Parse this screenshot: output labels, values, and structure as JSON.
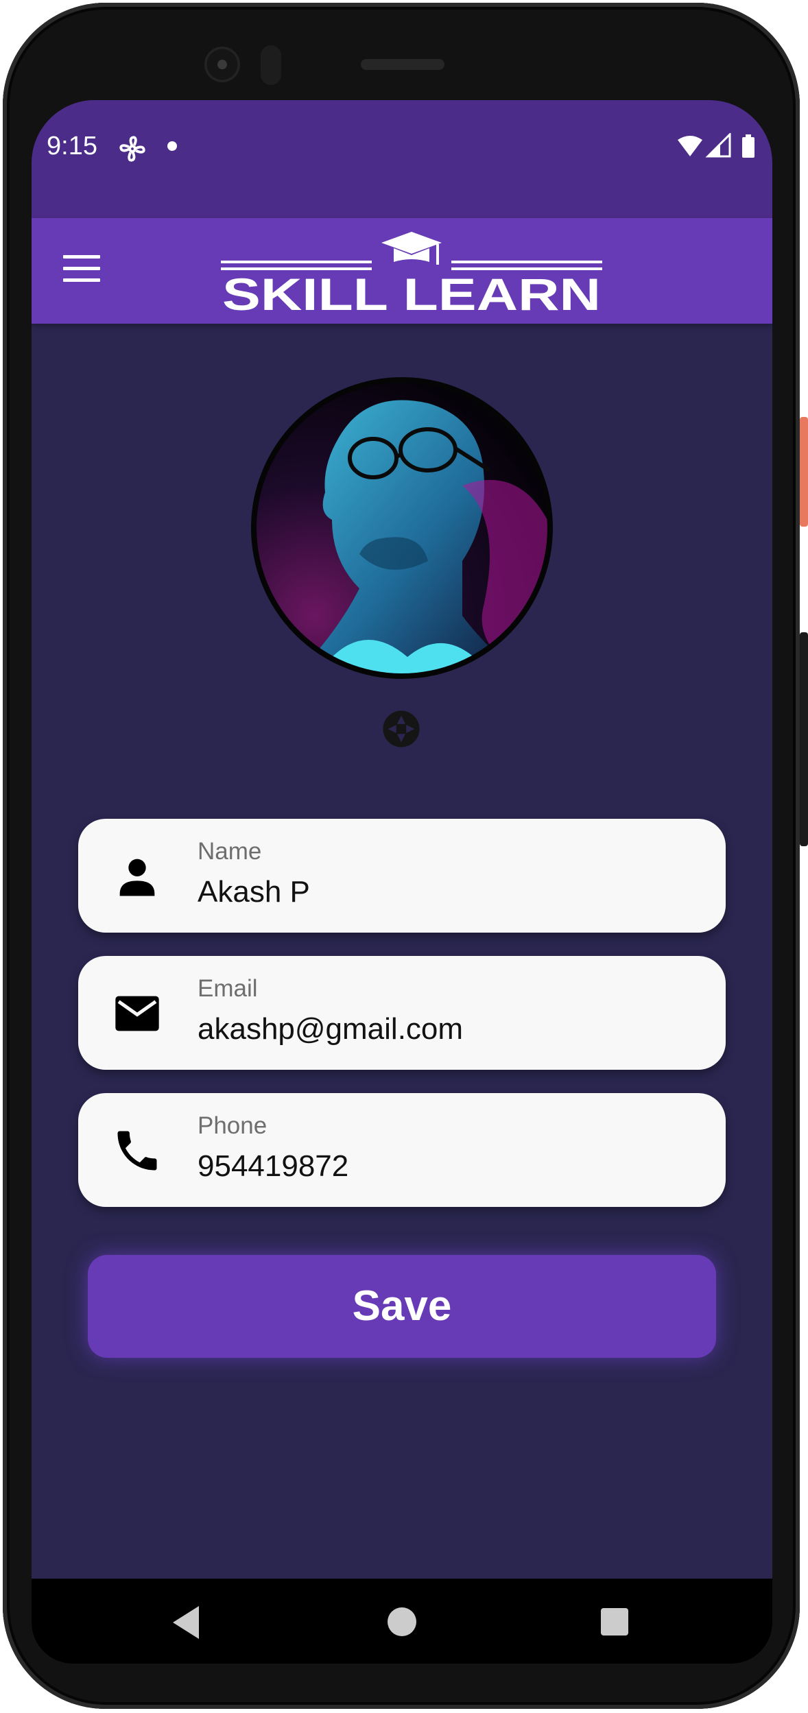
{
  "status_bar": {
    "time": "9:15",
    "icons": [
      "fan-icon",
      "notification-dot-icon",
      "wifi-icon",
      "signal-icon",
      "battery-icon"
    ]
  },
  "app_bar": {
    "logo_text": "SKILL LEARN",
    "menu_icon": "hamburger-menu-icon"
  },
  "profile": {
    "avatar_icon": "avatar-photo",
    "camera_icon": "camera-shutter-icon"
  },
  "fields": {
    "name": {
      "label": "Name",
      "value": "Akash P",
      "icon": "person-icon"
    },
    "email": {
      "label": "Email",
      "value": "akashp@gmail.com",
      "icon": "mail-icon"
    },
    "phone": {
      "label": "Phone",
      "value": "954419872",
      "icon": "phone-icon"
    }
  },
  "actions": {
    "save_label": "Save"
  },
  "navigation": {
    "back_icon": "back-icon",
    "home_icon": "home-icon",
    "recents_icon": "recents-icon"
  },
  "colors": {
    "status_bar": "#4c2c89",
    "app_bar": "#673ab6",
    "background": "#2a2650",
    "card": "#f8f8f8",
    "button": "#673ab6"
  }
}
